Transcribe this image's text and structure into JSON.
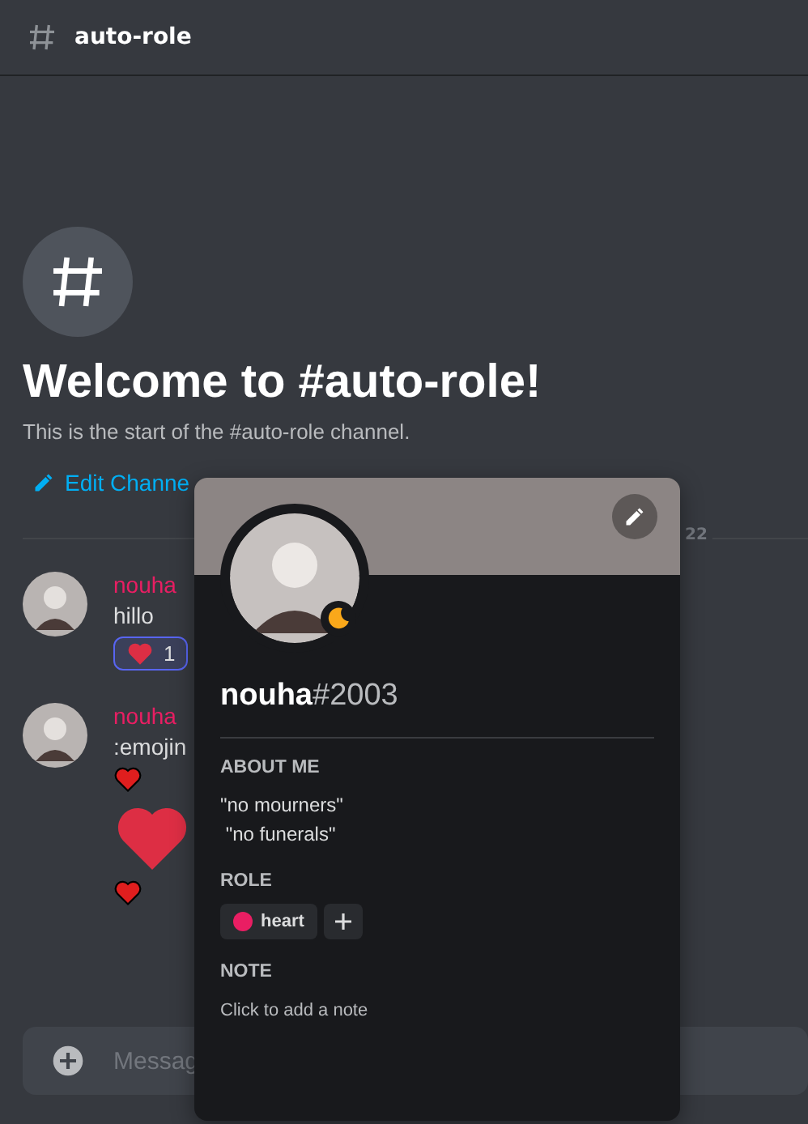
{
  "header": {
    "channel": "auto-role"
  },
  "welcome": {
    "title": "Welcome to #auto-role!",
    "subtitle": "This is the start of the #auto-role channel.",
    "edit_link": "Edit Channe"
  },
  "divider": {
    "date": "22"
  },
  "messages": [
    {
      "author": "nouha",
      "text": "hillo",
      "reactions": [
        {
          "count": "1",
          "selected": true
        }
      ]
    },
    {
      "author": "nouha",
      "text": ":emojin",
      "emojis": [
        {
          "kind": "small"
        },
        {
          "kind": "large"
        },
        {
          "kind": "small"
        }
      ]
    }
  ],
  "composer": {
    "placeholder": "Messag"
  },
  "profile": {
    "username": "nouha",
    "discriminator": "#2003",
    "idle": true,
    "sections": [
      {
        "kind": "text",
        "heading": "ABOUT ME",
        "lines": [
          "\"no mourners\"",
          " \"no funerals\""
        ]
      },
      {
        "kind": "roles",
        "heading": "ROLE",
        "roles": [
          {
            "name": "heart",
            "color": "#e91e63"
          }
        ]
      },
      {
        "kind": "note",
        "heading": "NOTE",
        "placeholder": "Click to add a note"
      }
    ]
  }
}
